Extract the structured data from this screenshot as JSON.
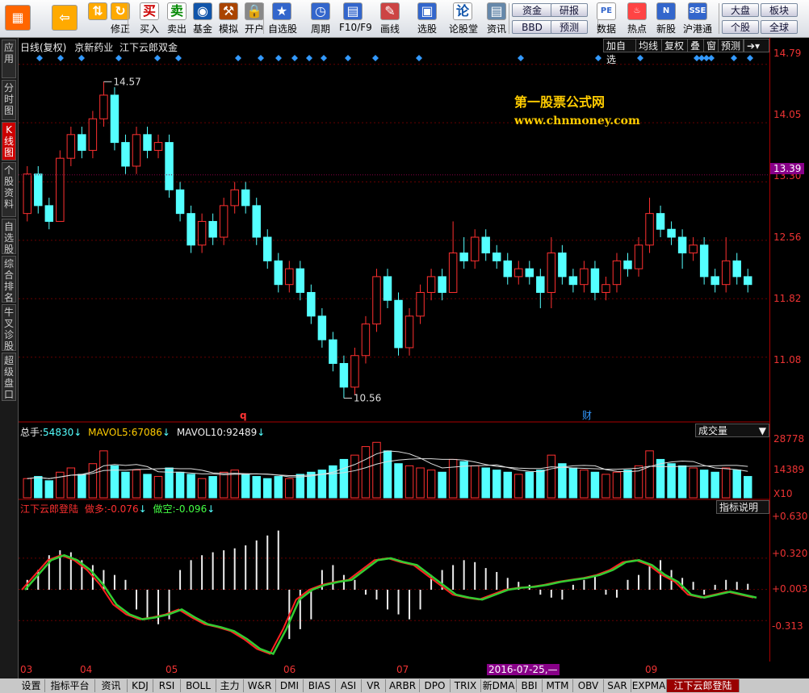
{
  "toolbar": {
    "items": [
      {
        "label": "",
        "icon": "windows-grid-icon"
      },
      {
        "label": "",
        "icon": "back-arrow-icon"
      },
      {
        "label": "",
        "icon": "up-down-arrow-icon"
      },
      {
        "label": "修正",
        "icon": "refresh-icon"
      },
      {
        "label": "买入",
        "icon": "buy-icon",
        "glyph": "买"
      },
      {
        "label": "卖出",
        "icon": "sell-icon",
        "glyph": "卖"
      },
      {
        "label": "基金",
        "icon": "fund-icon"
      },
      {
        "label": "模拟",
        "icon": "hammer-icon"
      },
      {
        "label": "开户",
        "icon": "lock-icon"
      },
      {
        "label": "自选股",
        "icon": "star-folder-icon"
      },
      {
        "label": "周期",
        "icon": "clock-icon"
      },
      {
        "label": "F10/F9",
        "icon": "document-icon"
      },
      {
        "label": "画线",
        "icon": "pen-icon"
      },
      {
        "label": "选股",
        "icon": "screen-icon"
      },
      {
        "label": "论股堂",
        "icon": "forum-icon",
        "glyph": "论"
      },
      {
        "label": "资讯",
        "icon": "news-icon"
      }
    ],
    "small_buttons": [
      "资金",
      "BBD",
      "研报",
      "预测"
    ],
    "right_items": [
      {
        "label": "数据",
        "icon": "pe-icon",
        "glyph": "PE"
      },
      {
        "label": "热点",
        "icon": "fire-icon"
      },
      {
        "label": "新股",
        "icon": "new-stock-icon"
      },
      {
        "label": "沪港通",
        "icon": "sse-hkex-icon"
      }
    ],
    "right_buttons": [
      "大盘",
      "板块",
      "个股",
      "全球"
    ]
  },
  "left_tabs": [
    "应用",
    "分时图",
    "K线图",
    "个股资料",
    "自选股",
    "综合排名",
    "牛叉诊股",
    "超级盘口"
  ],
  "header": {
    "period": "日线(复权)",
    "stock": "京新药业",
    "indicator": "江下云郎双金"
  },
  "top_buttons": [
    "加自选",
    "均线",
    "复权",
    "叠",
    "窗",
    "预测"
  ],
  "watermark": {
    "line1": "第一股票公式网",
    "line2": "www.chnmoney.com"
  },
  "price_axis": {
    "labels": [
      "14.79",
      "14.05",
      "13.30",
      "12.56",
      "11.82",
      "11.08"
    ],
    "current": "13.39"
  },
  "annotations": {
    "high": "14.57",
    "low": "10.56",
    "q_marker": "q",
    "cai_marker": "财"
  },
  "volume": {
    "label_total": "总手:",
    "total": "54830",
    "mavol5_label": "MAVOL5:",
    "mavol5": "67086",
    "mavol10_label": "MAVOL10:",
    "mavol10": "92489",
    "panel_label": "成交量",
    "axis": [
      "28778",
      "14389",
      "X10"
    ]
  },
  "indicator_panel": {
    "name": "江下云郎登陆",
    "duo_label": "做多:",
    "duo": "-0.076",
    "kong_label": "做空:",
    "kong": "-0.096",
    "button": "指标说明",
    "axis": [
      "+0.630",
      "+0.320",
      "+0.003",
      "-0.313"
    ]
  },
  "dates": {
    "labels": [
      "03",
      "04",
      "05",
      "06",
      "07",
      "09"
    ],
    "highlight": "2016-07-25,—"
  },
  "bottom_tabs": [
    "设置",
    "指标平台",
    "资讯",
    "KDJ",
    "RSI",
    "BOLL",
    "主力",
    "W&R",
    "DMI",
    "BIAS",
    "ASI",
    "VR",
    "ARBR",
    "DPO",
    "TRIX",
    "新DMA",
    "BBI",
    "MTM",
    "OBV",
    "SAR",
    "EXPMA",
    "江下云郎登陆"
  ],
  "colors": {
    "up": "#ff3030",
    "down": "#54ffff",
    "accent": "#ffcc00"
  },
  "chart_data": {
    "type": "candlestick",
    "candles": [
      [
        12.9,
        13.4,
        13.5,
        12.8
      ],
      [
        13.4,
        13.0,
        13.5,
        12.9
      ],
      [
        13.0,
        12.8,
        13.1,
        12.7
      ],
      [
        12.8,
        13.6,
        13.7,
        12.8
      ],
      [
        13.6,
        13.9,
        14.0,
        13.5
      ],
      [
        13.9,
        13.7,
        14.0,
        13.6
      ],
      [
        13.7,
        14.1,
        14.2,
        13.6
      ],
      [
        14.1,
        14.4,
        14.57,
        14.0
      ],
      [
        14.4,
        13.8,
        14.5,
        13.7
      ],
      [
        13.8,
        13.5,
        13.9,
        13.4
      ],
      [
        13.5,
        13.9,
        14.0,
        13.4
      ],
      [
        13.9,
        13.7,
        14.0,
        13.6
      ],
      [
        13.7,
        13.8,
        13.9,
        13.6
      ],
      [
        13.8,
        13.2,
        13.9,
        13.1
      ],
      [
        13.2,
        12.9,
        13.3,
        12.8
      ],
      [
        12.9,
        12.5,
        13.0,
        12.4
      ],
      [
        12.5,
        12.8,
        12.9,
        12.4
      ],
      [
        12.8,
        12.6,
        12.9,
        12.5
      ],
      [
        12.6,
        13.0,
        13.1,
        12.5
      ],
      [
        13.0,
        13.2,
        13.3,
        12.9
      ],
      [
        13.2,
        13.0,
        13.3,
        12.9
      ],
      [
        13.0,
        12.6,
        13.1,
        12.5
      ],
      [
        12.6,
        12.3,
        12.7,
        12.2
      ],
      [
        12.3,
        12.0,
        12.4,
        11.9
      ],
      [
        12.0,
        12.2,
        12.3,
        11.9
      ],
      [
        12.2,
        11.9,
        12.3,
        11.8
      ],
      [
        11.9,
        11.6,
        12.0,
        11.5
      ],
      [
        11.6,
        11.3,
        11.7,
        11.2
      ],
      [
        11.3,
        11.0,
        11.4,
        10.9
      ],
      [
        11.0,
        10.7,
        11.1,
        10.56
      ],
      [
        10.7,
        11.1,
        11.2,
        10.6
      ],
      [
        11.1,
        11.5,
        11.6,
        11.0
      ],
      [
        11.5,
        12.1,
        12.2,
        11.4
      ],
      [
        12.1,
        11.8,
        12.2,
        11.7
      ],
      [
        11.8,
        11.2,
        11.9,
        11.1
      ],
      [
        11.2,
        11.6,
        11.7,
        11.1
      ],
      [
        11.6,
        11.9,
        12.0,
        11.5
      ],
      [
        11.9,
        12.1,
        12.2,
        11.8
      ],
      [
        12.1,
        11.9,
        12.2,
        11.8
      ],
      [
        11.9,
        12.4,
        12.8,
        11.9
      ],
      [
        12.4,
        12.3,
        12.6,
        12.2
      ],
      [
        12.3,
        12.6,
        12.7,
        12.2
      ],
      [
        12.6,
        12.4,
        12.7,
        12.3
      ],
      [
        12.4,
        12.3,
        12.5,
        12.2
      ],
      [
        12.3,
        12.1,
        12.4,
        12.0
      ],
      [
        12.1,
        12.2,
        12.3,
        12.0
      ],
      [
        12.2,
        12.1,
        12.3,
        12.0
      ],
      [
        12.1,
        11.9,
        12.2,
        11.7
      ],
      [
        11.9,
        12.4,
        12.6,
        11.7
      ],
      [
        12.4,
        12.1,
        12.5,
        12.0
      ],
      [
        12.1,
        12.0,
        12.2,
        11.9
      ],
      [
        12.0,
        12.2,
        12.3,
        11.9
      ],
      [
        12.2,
        11.9,
        12.3,
        11.8
      ],
      [
        11.9,
        12.0,
        12.1,
        11.8
      ],
      [
        12.0,
        12.3,
        12.4,
        11.9
      ],
      [
        12.3,
        12.2,
        12.4,
        12.1
      ],
      [
        12.2,
        12.5,
        12.6,
        12.1
      ],
      [
        12.5,
        12.9,
        13.1,
        12.4
      ],
      [
        12.9,
        12.7,
        13.0,
        12.6
      ],
      [
        12.7,
        12.6,
        12.8,
        12.5
      ],
      [
        12.6,
        12.4,
        12.7,
        12.2
      ],
      [
        12.4,
        12.5,
        12.6,
        12.3
      ],
      [
        12.5,
        12.1,
        12.6,
        12.0
      ],
      [
        12.1,
        12.0,
        12.2,
        11.9
      ],
      [
        12.0,
        12.3,
        12.6,
        11.9
      ],
      [
        12.3,
        12.1,
        12.4,
        12.0
      ],
      [
        12.1,
        12.0,
        12.2,
        11.9
      ]
    ],
    "volume": [
      9,
      10,
      8,
      12,
      14,
      11,
      16,
      22,
      15,
      12,
      13,
      11,
      10,
      14,
      12,
      11,
      9,
      10,
      12,
      13,
      11,
      10,
      9,
      10,
      9,
      11,
      12,
      13,
      15,
      18,
      20,
      24,
      26,
      22,
      16,
      15,
      14,
      13,
      12,
      18,
      17,
      15,
      14,
      13,
      12,
      11,
      12,
      13,
      20,
      16,
      14,
      13,
      12,
      11,
      12,
      13,
      15,
      22,
      18,
      16,
      15,
      14,
      13,
      12,
      14,
      13,
      10
    ],
    "indicator_bars": [
      0.1,
      0.2,
      0.35,
      0.4,
      0.38,
      0.3,
      0.25,
      0.2,
      0.15,
      0.1,
      -0.2,
      -0.3,
      -0.35,
      -0.3,
      0.2,
      0.3,
      0.35,
      0.38,
      0.4,
      0.42,
      0.45,
      0.5,
      0.55,
      0.6,
      -0.5,
      -0.4,
      -0.3,
      0.2,
      0.25,
      0.15,
      0.1,
      -0.05,
      -0.1,
      -0.2,
      -0.25,
      -0.3,
      -0.2,
      0.15,
      0.2,
      0.25,
      0.3,
      0.28,
      0.22,
      0.18,
      0.12,
      0.08,
      0.05,
      -0.05,
      -0.08,
      -0.1,
      0.05,
      0.1,
      0.15,
      -0.05,
      -0.08,
      0.1,
      0.15,
      0.25,
      0.3,
      0.2,
      0.12,
      0.08,
      -0.05,
      0.05,
      0.1,
      0.08,
      0.06
    ],
    "line_duo": [
      0.0,
      0.15,
      0.3,
      0.35,
      0.3,
      0.2,
      0.05,
      -0.15,
      -0.25,
      -0.3,
      -0.28,
      -0.25,
      -0.2,
      -0.28,
      -0.35,
      -0.38,
      -0.42,
      -0.5,
      -0.6,
      -0.65,
      -0.4,
      -0.1,
      0.0,
      0.05,
      0.08,
      0.1,
      0.2,
      0.3,
      0.32,
      0.28,
      0.25,
      0.15,
      0.05,
      -0.05,
      -0.08,
      -0.1,
      -0.05,
      0.0,
      0.02,
      0.03,
      0.05,
      0.08,
      0.1,
      0.12,
      0.15,
      0.2,
      0.28,
      0.3,
      0.25,
      0.15,
      0.08,
      -0.05,
      -0.08,
      -0.05,
      -0.02,
      -0.05,
      -0.08
    ],
    "ylim_price": [
      10.3,
      14.9
    ],
    "ylim_volume": [
      0,
      28778
    ],
    "ylim_indicator": [
      -0.72,
      0.72
    ]
  }
}
